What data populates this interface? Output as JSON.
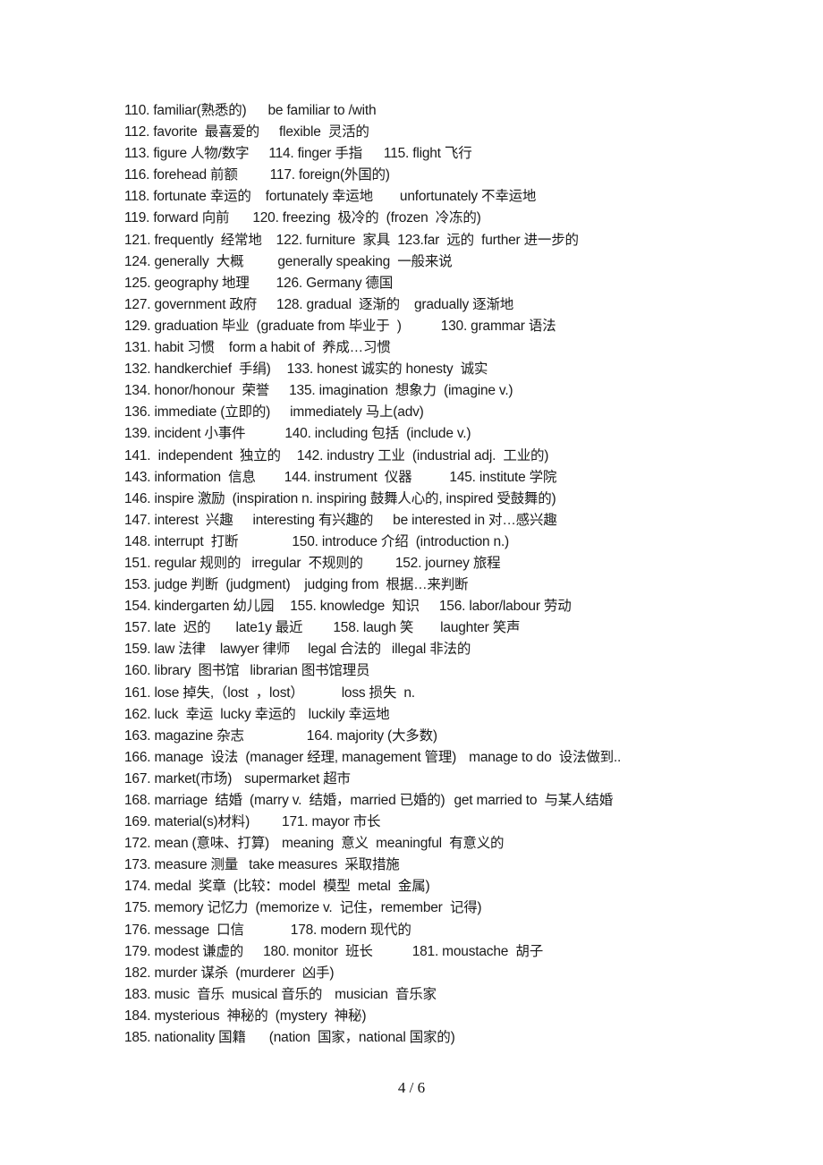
{
  "document": {
    "lines": [
      [
        "110. familiar(熟悉的)",
        "be familiar to /with"
      ],
      [
        "112. favorite  最喜爱的",
        "flexible  灵活的"
      ],
      [
        "113. figure 人物/数字",
        "114. finger 手指",
        "115. flight 飞行"
      ],
      [
        "116. forehead 前额",
        "117. foreign(外国的)"
      ],
      [
        "118. fortunate 幸运的",
        "fortunately 幸运地",
        "unfortunately 不幸运地"
      ],
      [
        "119. forward 向前",
        "120. freezing  极冷的  (frozen  冷冻的)"
      ],
      [
        "121. frequently  经常地",
        "122. furniture  家具  123.far  远的  further 进一步的"
      ],
      [
        "124. generally  大概",
        "generally speaking  一般来说"
      ],
      [
        "125. geography 地理",
        "126. Germany 德国"
      ],
      [
        "127. government 政府",
        "128. gradual  逐渐的",
        "gradually 逐渐地"
      ],
      [
        "129. graduation 毕业  (graduate from 毕业于  )",
        "130. grammar 语法"
      ],
      [
        "131. habit 习惯",
        "form a habit of  养成…习惯"
      ],
      [
        "132. handkerchief  手绢)",
        "133. honest 诚实的 honesty  诚实"
      ],
      [
        "134. honor/honour  荣誉",
        "135. imagination  想象力  (imagine v.)"
      ],
      [
        "136. immediate (立即的)",
        "immediately 马上(adv)"
      ],
      [
        "139. incident 小事件",
        "140. including 包括  (include v.)"
      ],
      [
        "141.  independent  独立的",
        "142. industry 工业  (industrial adj.  工业的)"
      ],
      [
        "143. information  信息",
        "144. instrument  仪器",
        "145. institute 学院"
      ],
      [
        "146. inspire 激励  (inspiration n. inspiring 鼓舞人心的, inspired 受鼓舞的)"
      ],
      [
        "147. interest  兴趣",
        "interesting 有兴趣的",
        "be interested in 对…感兴趣"
      ],
      [
        "148. interrupt  打断",
        "150. introduce 介绍  (introduction n.)"
      ],
      [
        "151. regular 规则的",
        "irregular  不规则的",
        "152. journey 旅程"
      ],
      [
        "153. judge 判断  (judgment)",
        "judging from  根据…来判断"
      ],
      [
        "154. kindergarten 幼儿园",
        "155. knowledge  知识",
        "156. labor/labour 劳动"
      ],
      [
        "157. late  迟的",
        "late1y 最近",
        "158. laugh 笑",
        "laughter 笑声"
      ],
      [
        "159. law 法律",
        "lawyer 律师",
        "legal 合法的",
        "illegal 非法的"
      ],
      [
        "160. library  图书馆",
        "librarian 图书馆理员"
      ],
      [
        "161. lose 掉失,（lost  ，lost）",
        "loss 损失  n."
      ],
      [
        "162. luck  幸运  lucky 幸运的",
        "luckily 幸运地"
      ],
      [
        "163. magazine 杂志",
        "164. majority (大多数)"
      ],
      [
        "166. manage  设法  (manager 经理, management 管理)",
        "manage to do  设法做到.."
      ],
      [
        "167. market(市场)",
        "supermarket 超市"
      ],
      [
        "168. marriage  结婚  (marry v.  结婚，married 已婚的)",
        "get married to  与某人结婚"
      ],
      [
        "169. material(s)材料)",
        "171. mayor 市长"
      ],
      [
        "172. mean (意味、打算)",
        "meaning  意义  meaningful  有意义的"
      ],
      [
        "173. measure 测量",
        "take measures  采取措施"
      ],
      [
        "174. medal  奖章  (比较：model  模型  metal  金属)"
      ],
      [
        "175. memory 记忆力  (memorize v.  记住，remember  记得)"
      ],
      [
        "176. message  口信",
        "178. modern 现代的"
      ],
      [
        "179. modest 谦虚的",
        "180. monitor  班长",
        "181. moustache  胡子"
      ],
      [
        "182. murder 谋杀  (murderer  凶手)"
      ],
      [
        "183. music  音乐  musical 音乐的",
        "musician  音乐家"
      ],
      [
        "184. mysterious  神秘的  (mystery  神秘)"
      ],
      [
        "185. nationality 国籍",
        "(nation  国家，national 国家的)"
      ]
    ],
    "page_number": "4  / 6"
  }
}
